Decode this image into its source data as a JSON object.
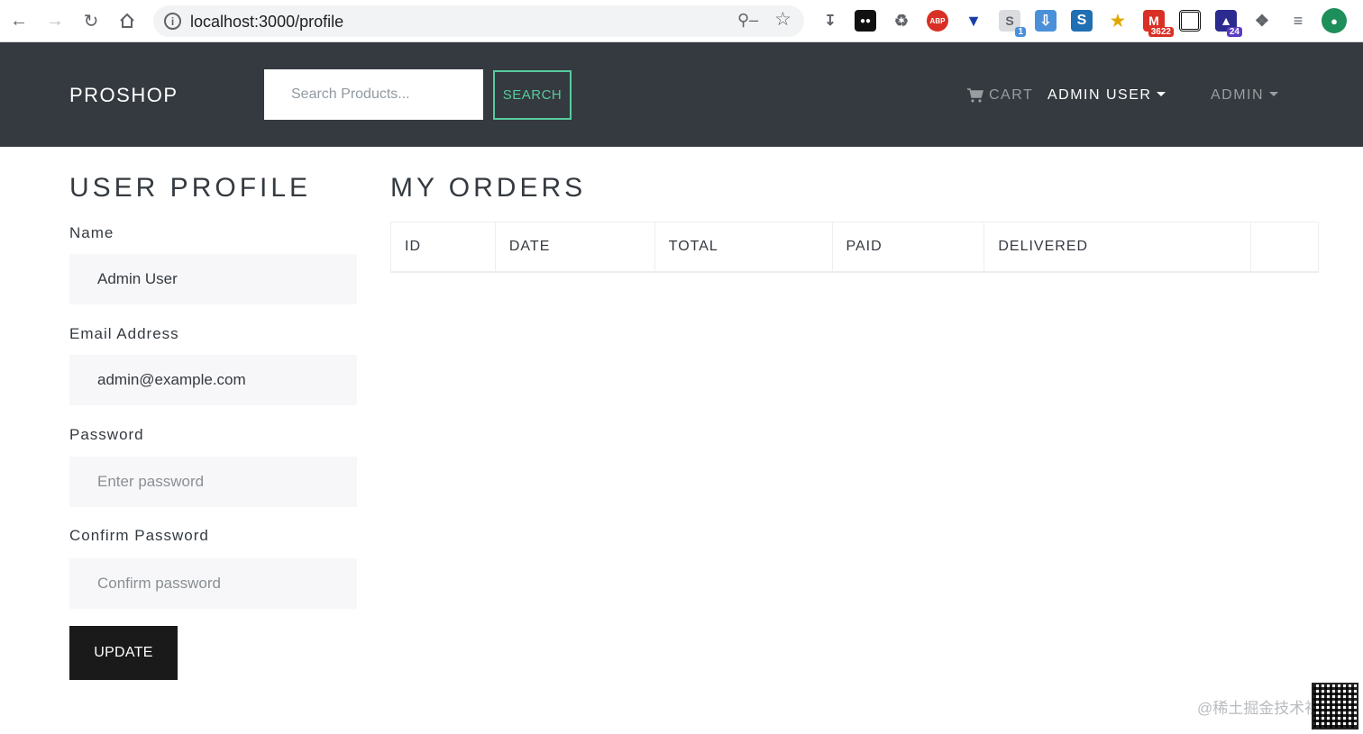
{
  "browser": {
    "url": "localhost:3000/profile",
    "extension_badges": {
      "s": "1",
      "gmail": "3622",
      "hat": "24"
    },
    "extension_labels": {
      "abp": "ABP"
    }
  },
  "navbar": {
    "brand": "PROSHOP",
    "search_placeholder": "Search Products...",
    "search_button": "SEARCH",
    "cart": "CART",
    "user_menu": "ADMIN USER",
    "admin_menu": "ADMIN"
  },
  "profile": {
    "title": "USER PROFILE",
    "name_label": "Name",
    "name_value": "Admin User",
    "email_label": "Email Address",
    "email_value": "admin@example.com",
    "password_label": "Password",
    "password_placeholder": "Enter password",
    "confirm_label": "Confirm Password",
    "confirm_placeholder": "Confirm password",
    "update_button": "UPDATE"
  },
  "orders": {
    "title": "MY ORDERS",
    "columns": [
      "ID",
      "DATE",
      "TOTAL",
      "PAID",
      "DELIVERED",
      ""
    ]
  },
  "watermark": "@稀土掘金技术社区",
  "colors": {
    "navbar_bg": "#343a40",
    "accent": "#56cc9d",
    "button_dark": "#1a1a1a"
  }
}
